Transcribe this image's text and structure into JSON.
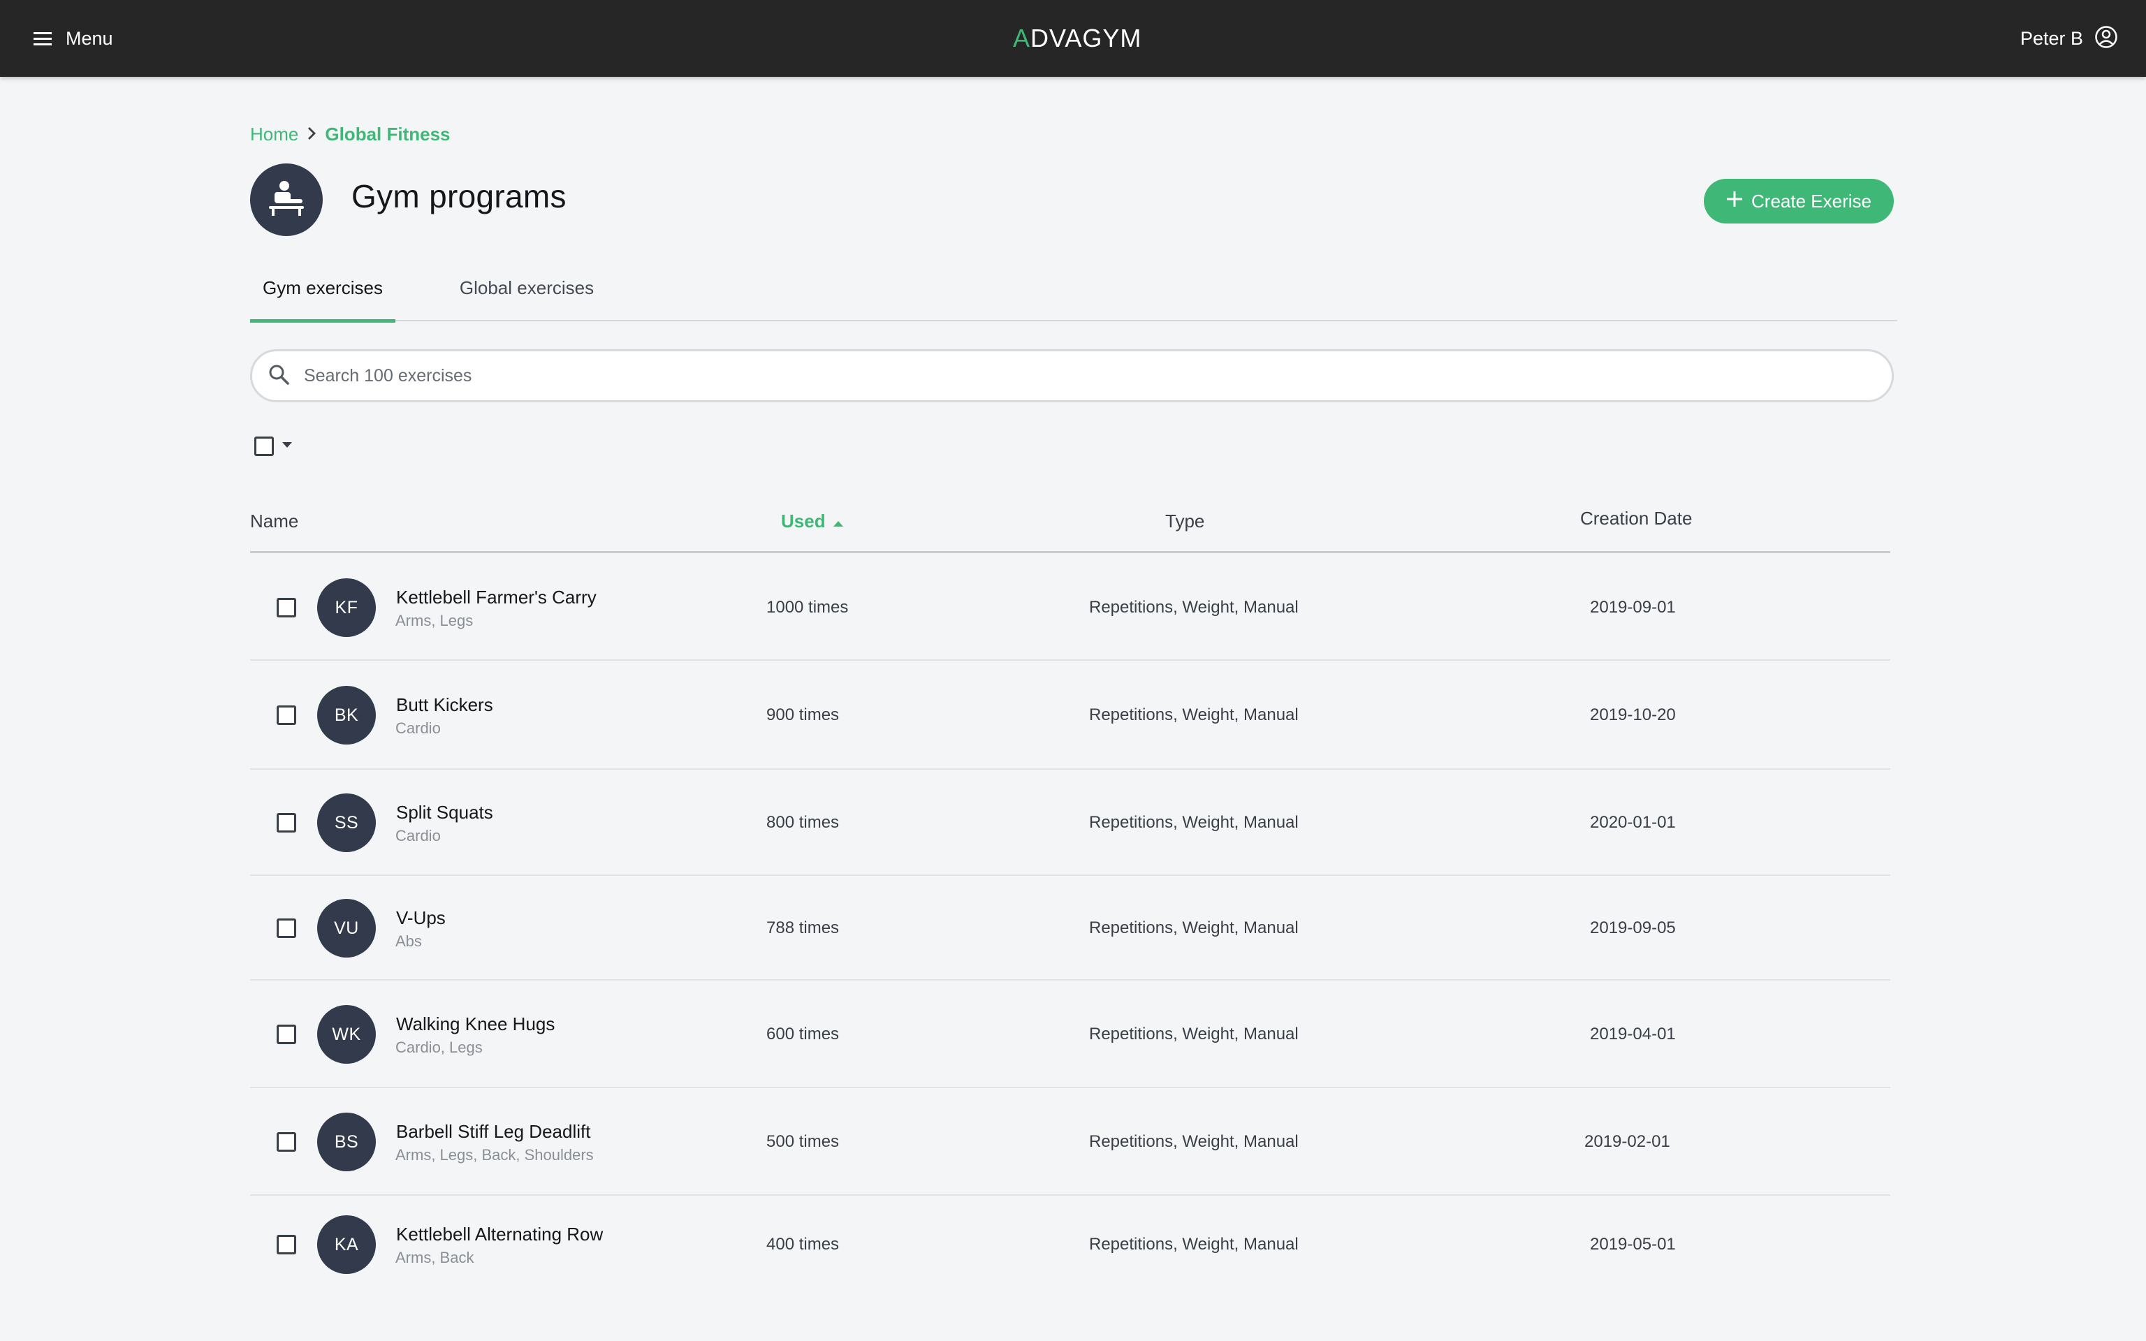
{
  "topbar": {
    "menu_label": "Menu",
    "logo_mark": "A",
    "logo_rest": "DVAGYM",
    "user_name": "Peter B",
    "accent": "#3fb877",
    "bar_color": "#262626"
  },
  "breadcrumb": {
    "home": "Home",
    "current": "Global Fitness"
  },
  "header": {
    "title": "Gym programs",
    "icon": "exercise-bench-icon",
    "create_label": "Create Exerise"
  },
  "tabs": [
    {
      "label": "Gym exercises",
      "active": true
    },
    {
      "label": "Global exercises",
      "active": false
    }
  ],
  "search": {
    "placeholder": "Search 100 exercises",
    "value": ""
  },
  "table": {
    "columns": {
      "name": "Name",
      "used": "Used",
      "type": "Type",
      "created": "Creation Date"
    },
    "sort": {
      "column": "Used",
      "direction": "ascending"
    },
    "rows": [
      {
        "initials": "KF",
        "name": "Kettlebell Farmer's Carry",
        "tags": "Arms, Legs",
        "used": "1000 times",
        "type": "Repetitions, Weight, Manual",
        "created": "2019-09-01"
      },
      {
        "initials": "BK",
        "name": "Butt Kickers",
        "tags": "Cardio",
        "used": "900 times",
        "type": "Repetitions, Weight, Manual",
        "created": "2019-10-20"
      },
      {
        "initials": "SS",
        "name": "Split Squats",
        "tags": "Cardio",
        "used": "800 times",
        "type": "Repetitions, Weight, Manual",
        "created": "2020-01-01"
      },
      {
        "initials": "VU",
        "name": "V-Ups",
        "tags": "Abs",
        "used": "788 times",
        "type": "Repetitions, Weight, Manual",
        "created": "2019-09-05"
      },
      {
        "initials": "WK",
        "name": "Walking Knee Hugs",
        "tags": "Cardio, Legs",
        "used": "600 times",
        "type": "Repetitions, Weight, Manual",
        "created": "2019-04-01"
      },
      {
        "initials": "BS",
        "name": "Barbell Stiff Leg Deadlift",
        "tags": "Arms, Legs, Back, Shoulders",
        "used": "500 times",
        "type": "Repetitions, Weight, Manual",
        "created": "2019-02-01"
      },
      {
        "initials": "KA",
        "name": "Kettlebell Alternating Row",
        "tags": "Arms, Back",
        "used": "400 times",
        "type": "Repetitions, Weight, Manual",
        "created": "2019-05-01"
      }
    ]
  }
}
